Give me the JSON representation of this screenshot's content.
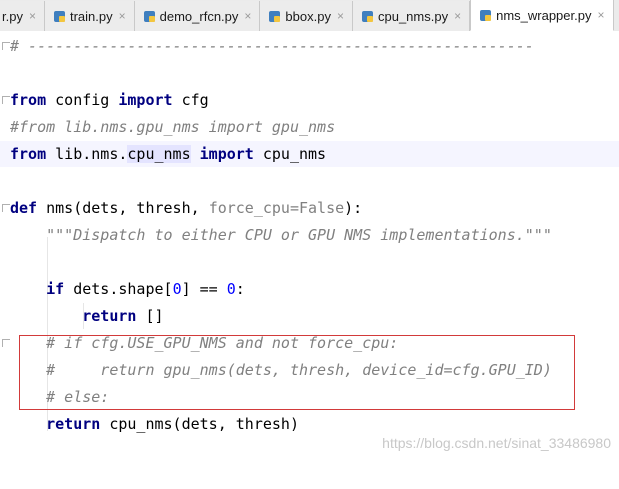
{
  "tabs": [
    {
      "label": "r.py",
      "active": false
    },
    {
      "label": "train.py",
      "active": false
    },
    {
      "label": "demo_rfcn.py",
      "active": false
    },
    {
      "label": "bbox.py",
      "active": false
    },
    {
      "label": "cpu_nms.py",
      "active": false
    },
    {
      "label": "nms_wrapper.py",
      "active": true
    }
  ],
  "close_glyph": "×",
  "code": {
    "l1": "# --------------------------------------------------------",
    "l3a": "from",
    "l3b": " config ",
    "l3c": "import",
    "l3d": " cfg",
    "l4": "#from lib.nms.gpu_nms import gpu_nms",
    "l5a": "from",
    "l5b": " lib.nms.",
    "l5c": "cpu_nms",
    "l5d": " ",
    "l5e": "import",
    "l5f": " cpu_nms",
    "l7a": "def",
    "l7b": " nms(dets, thresh, ",
    "l7c": "force_cpu=False",
    "l7d": "):",
    "l8": "    \"\"\"Dispatch to either CPU or GPU NMS implementations.\"\"\"",
    "l10a": "    ",
    "l10b": "if",
    "l10c": " dets.shape[",
    "l10d": "0",
    "l10e": "] == ",
    "l10f": "0",
    "l10g": ":",
    "l11a": "        ",
    "l11b": "return",
    "l11c": " []",
    "l12": "    # if cfg.USE_GPU_NMS and not force_cpu:",
    "l13": "    #     return gpu_nms(dets, thresh, device_id=cfg.GPU_ID)",
    "l14": "    # else:",
    "l15a": "    ",
    "l15b": "return",
    "l15c": " cpu_nms(dets, thresh)"
  },
  "watermark": "https://blog.csdn.net/sinat_33486980",
  "colors": {
    "keyword": "#000080",
    "comment": "#808080",
    "number": "#0000ff",
    "highlight_box": "#d23a3a"
  }
}
